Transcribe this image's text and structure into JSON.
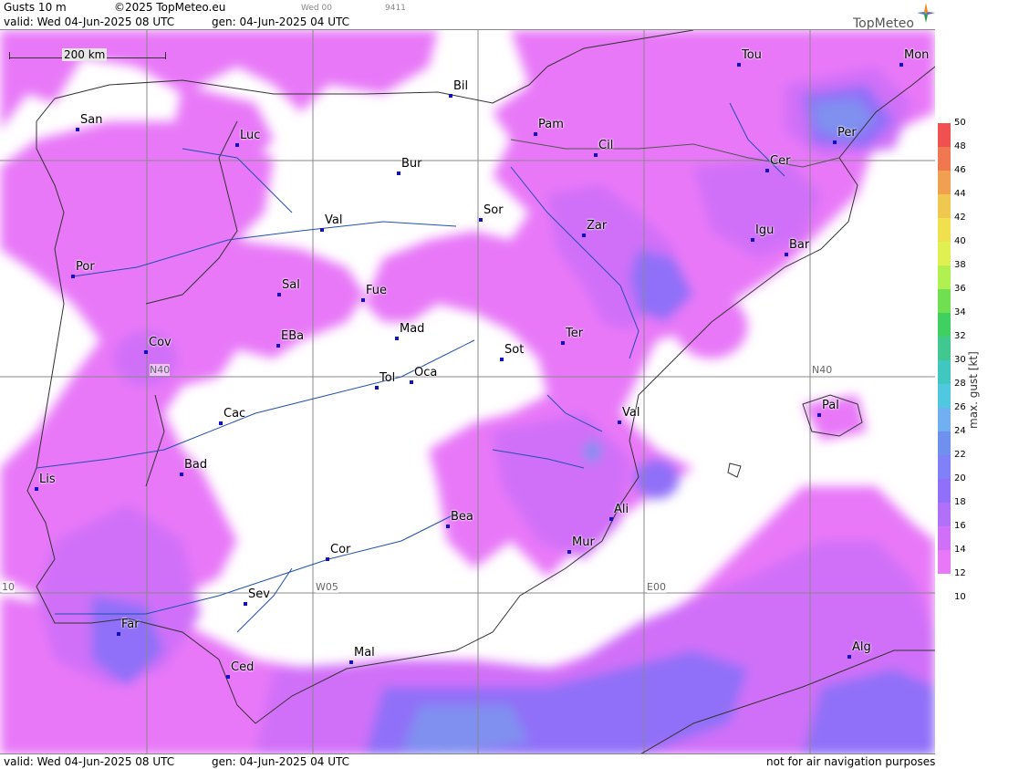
{
  "header": {
    "product": "Gusts 10 m",
    "copyright": "©2025 TopMeteo.eu",
    "run_small": "Wed 00",
    "run_code": "9411",
    "valid": "valid:  Wed  04-Jun-2025  08 UTC",
    "gen": "gen: 04-Jun-2025 04 UTC"
  },
  "footer": {
    "valid": "valid:  Wed  04-Jun-2025  08 UTC",
    "gen": "gen: 04-Jun-2025 04 UTC",
    "disclaimer": "not for air navigation purposes"
  },
  "logo": {
    "text": "TopMeteo"
  },
  "scale": {
    "label": "200 km"
  },
  "grid_labels": {
    "n40_left": "N40",
    "n40_right": "N40",
    "w05": "W05",
    "e00": "E00",
    "w10": "10"
  },
  "legend": {
    "title": "max. gust  [kt]",
    "levels": [
      "50",
      "48",
      "46",
      "44",
      "42",
      "40",
      "38",
      "36",
      "34",
      "32",
      "30",
      "28",
      "26",
      "24",
      "22",
      "20",
      "18",
      "16",
      "14",
      "12",
      "10"
    ],
    "colors": [
      "#f05050",
      "#f07850",
      "#f0a050",
      "#f0c850",
      "#f0e050",
      "#e0f050",
      "#b0f050",
      "#70e050",
      "#40d060",
      "#40c890",
      "#40c8c0",
      "#50c8e0",
      "#70b0f0",
      "#7090f0",
      "#8080f8",
      "#9070f8",
      "#b070f8",
      "#d070f8",
      "#e878f8",
      "#ffffff"
    ]
  },
  "cities": [
    {
      "id": "tou",
      "name": "Tou"
    },
    {
      "id": "mon",
      "name": "Mon"
    },
    {
      "id": "bil",
      "name": "Bil"
    },
    {
      "id": "pam",
      "name": "Pam"
    },
    {
      "id": "san",
      "name": "San"
    },
    {
      "id": "luc",
      "name": "Luc"
    },
    {
      "id": "per",
      "name": "Per"
    },
    {
      "id": "cil",
      "name": "Cil"
    },
    {
      "id": "cer",
      "name": "Cer"
    },
    {
      "id": "bur",
      "name": "Bur"
    },
    {
      "id": "sor",
      "name": "Sor"
    },
    {
      "id": "val1",
      "name": "Val"
    },
    {
      "id": "zar",
      "name": "Zar"
    },
    {
      "id": "igu",
      "name": "Igu"
    },
    {
      "id": "bar",
      "name": "Bar"
    },
    {
      "id": "por",
      "name": "Por"
    },
    {
      "id": "sal",
      "name": "Sal"
    },
    {
      "id": "fue",
      "name": "Fue"
    },
    {
      "id": "mad",
      "name": "Mad"
    },
    {
      "id": "ter",
      "name": "Ter"
    },
    {
      "id": "cov",
      "name": "Cov"
    },
    {
      "id": "eba",
      "name": "EBa"
    },
    {
      "id": "sot",
      "name": "Sot"
    },
    {
      "id": "tol",
      "name": "Tol"
    },
    {
      "id": "oca",
      "name": "Oca"
    },
    {
      "id": "pal",
      "name": "Pal"
    },
    {
      "id": "cac",
      "name": "Cac"
    },
    {
      "id": "val2",
      "name": "Val"
    },
    {
      "id": "bad",
      "name": "Bad"
    },
    {
      "id": "lis",
      "name": "Lis"
    },
    {
      "id": "ali",
      "name": "Ali"
    },
    {
      "id": "bea",
      "name": "Bea"
    },
    {
      "id": "mur",
      "name": "Mur"
    },
    {
      "id": "cor",
      "name": "Cor"
    },
    {
      "id": "sev",
      "name": "Sev"
    },
    {
      "id": "far",
      "name": "Far"
    },
    {
      "id": "alg",
      "name": "Alg"
    },
    {
      "id": "mal",
      "name": "Mal"
    },
    {
      "id": "ced",
      "name": "Ced"
    }
  ]
}
